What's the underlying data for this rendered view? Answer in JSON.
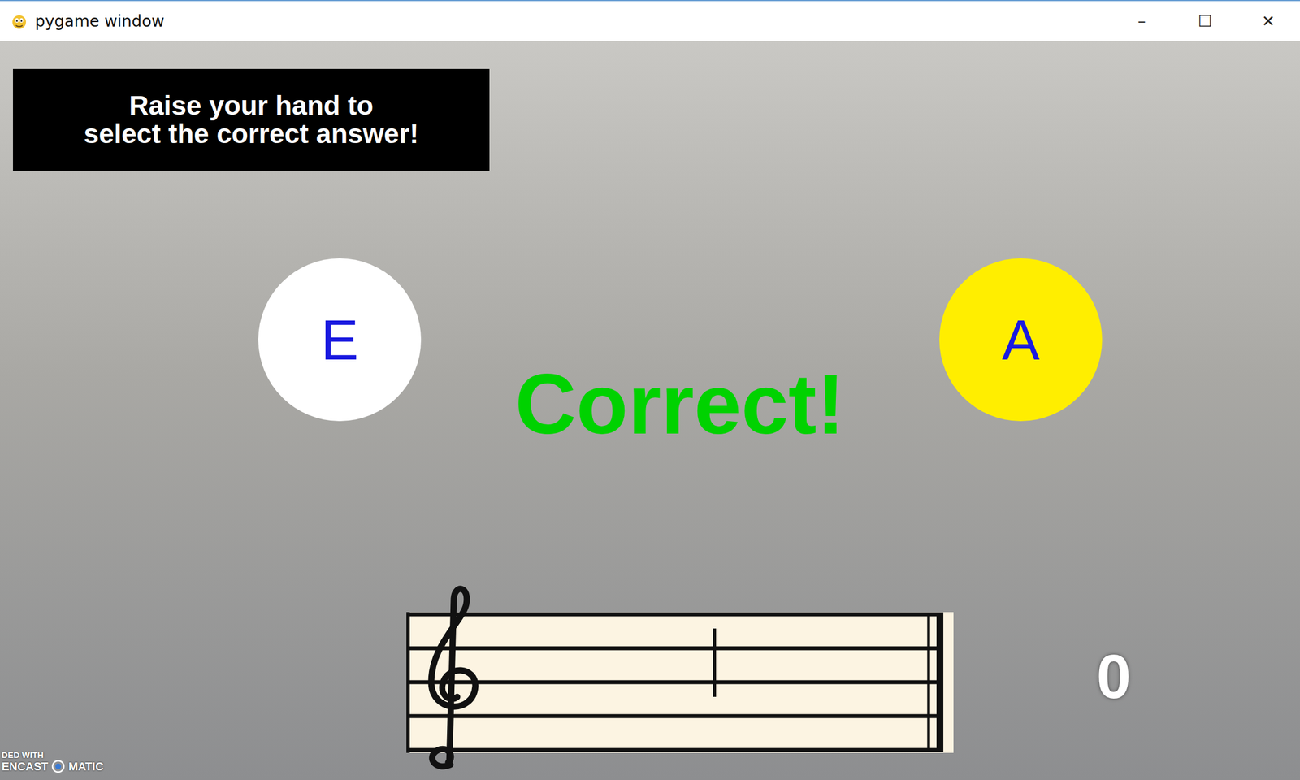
{
  "window": {
    "title": "pygame window",
    "controls": [
      "–",
      "☐",
      "✕"
    ]
  },
  "instruction": [
    "Raise your hand to",
    "select the correct answer!"
  ],
  "choices": [
    {
      "label": "E",
      "selected": false
    },
    {
      "label": "A",
      "selected": true
    }
  ],
  "feedback": {
    "text": "Correct!",
    "correct": true
  },
  "staff": {
    "note_step": 3
  },
  "score": "0",
  "watermark": {
    "top": "DED WITH",
    "left": "ENCAST",
    "right": "MATIC"
  }
}
